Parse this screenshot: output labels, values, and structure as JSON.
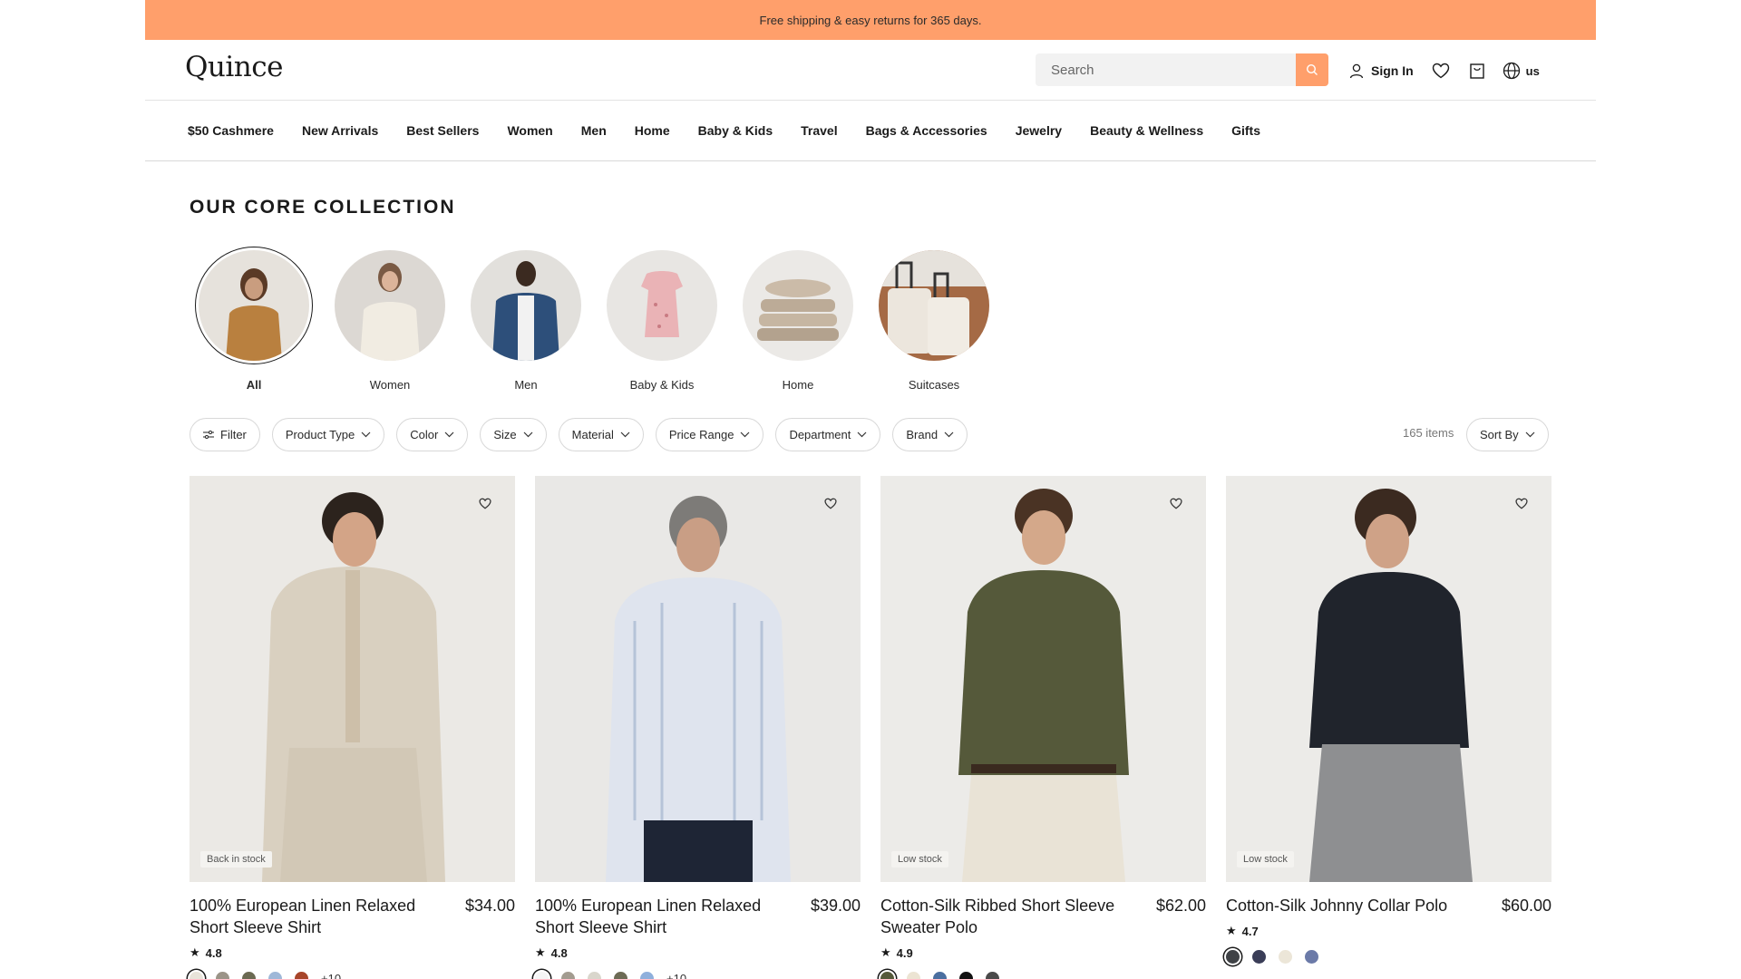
{
  "promo": {
    "text": "Free shipping & easy returns for 365 days."
  },
  "header": {
    "logo": "Quince",
    "search_placeholder": "Search",
    "sign_in": "Sign In",
    "locale": "us"
  },
  "nav": {
    "items": [
      "$50 Cashmere",
      "New Arrivals",
      "Best Sellers",
      "Women",
      "Men",
      "Home",
      "Baby & Kids",
      "Travel",
      "Bags & Accessories",
      "Jewelry",
      "Beauty & Wellness",
      "Gifts"
    ]
  },
  "collection": {
    "title": "OUR CORE COLLECTION",
    "categories": [
      {
        "label": "All",
        "active": true
      },
      {
        "label": "Women",
        "active": false
      },
      {
        "label": "Men",
        "active": false
      },
      {
        "label": "Baby & Kids",
        "active": false
      },
      {
        "label": "Home",
        "active": false
      },
      {
        "label": "Suitcases",
        "active": false
      }
    ]
  },
  "filters": {
    "filter": "Filter",
    "items": [
      "Product Type",
      "Color",
      "Size",
      "Material",
      "Price Range",
      "Department",
      "Brand"
    ],
    "count": "165 items",
    "sort": "Sort By"
  },
  "products": [
    {
      "title": "100% European Linen Relaxed Short Sleeve Shirt",
      "price": "$34.00",
      "rating": "4.8",
      "badge": "Back in stock",
      "swatches": [
        "#e8e4da",
        "#9b9488",
        "#6b6a52",
        "#9fb8d8",
        "#a8452a"
      ],
      "more": "+10"
    },
    {
      "title": "100% European Linen Relaxed Short Sleeve Shirt",
      "price": "$39.00",
      "rating": "4.8",
      "badge": "",
      "swatches": [
        "#f5f5f5",
        "#a39c90",
        "#d9d6cc",
        "#6d6b55",
        "#8fb0dc"
      ],
      "more": "+10"
    },
    {
      "title": "Cotton-Silk Ribbed Short Sleeve Sweater Polo",
      "price": "$62.00",
      "rating": "4.9",
      "badge": "Low stock",
      "swatches": [
        "#55593a",
        "#ece4d3",
        "#4b6fa0",
        "#111111",
        "#4a4a4a"
      ],
      "more": ""
    },
    {
      "title": "Cotton-Silk Johnny Collar Polo",
      "price": "$60.00",
      "rating": "4.7",
      "badge": "Low stock",
      "swatches": [
        "#3f4246",
        "#3a3d57",
        "#ece6d8",
        "#6b7aa8"
      ],
      "more": ""
    }
  ]
}
